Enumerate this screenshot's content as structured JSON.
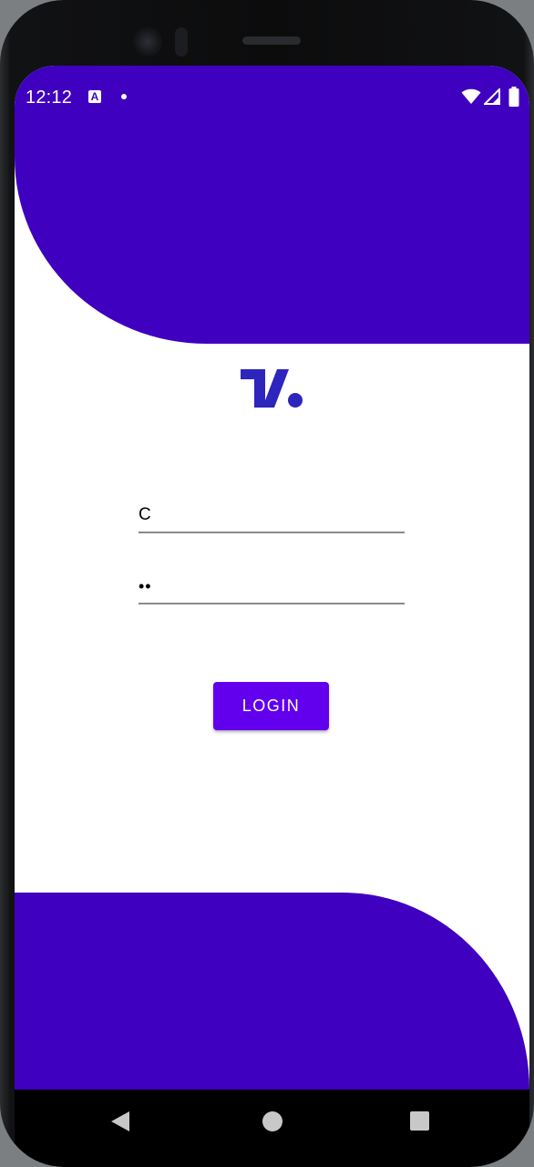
{
  "status_bar": {
    "time": "12:12",
    "notification_icon": "a-icon",
    "indicator": "dot-icon",
    "wifi_icon": "wifi-icon",
    "signal_icon": "signal-icon",
    "battery_icon": "battery-icon"
  },
  "logo": {
    "icon": "tradingview-logo-icon",
    "color": "#2e25bd"
  },
  "form": {
    "username_value": "C",
    "password_value": "••"
  },
  "login_button": {
    "label": "LOGIN"
  },
  "colors": {
    "wave": "#3f00bf",
    "button": "#6200ee",
    "background": "#ffffff"
  },
  "nav_bar": {
    "back_icon": "back-triangle-icon",
    "home_icon": "home-circle-icon",
    "recents_icon": "recents-square-icon"
  }
}
